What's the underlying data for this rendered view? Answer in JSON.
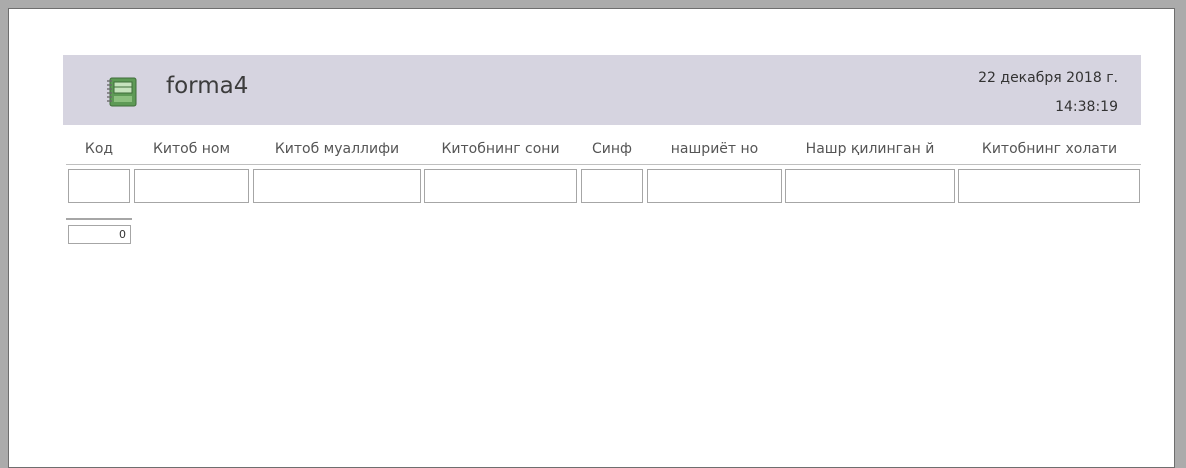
{
  "report": {
    "title": "forma4",
    "date": "22 декабря 2018 г.",
    "time": "14:38:19",
    "icon": "form-icon",
    "header_color": "#d6d4e0"
  },
  "columns": [
    "Код",
    "Китоб ном",
    "Китоб муаллифи",
    "Китобнинг сони",
    "Синф",
    "нашриёт но",
    "Нашр қилинган й",
    "Китобнинг холати"
  ],
  "footer": {
    "count": "0"
  }
}
